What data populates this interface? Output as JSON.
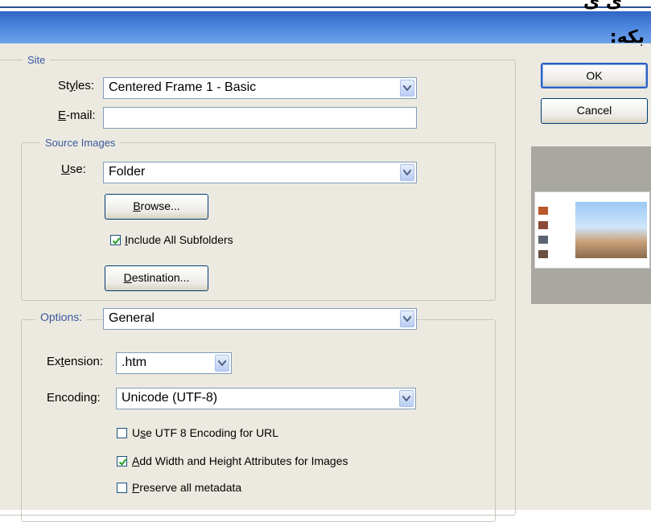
{
  "header": {
    "top_glyph": "ی ی",
    "rtl_text": "بکه:"
  },
  "site": {
    "legend": "Site",
    "styles_label_pre": "St",
    "styles_label_u": "y",
    "styles_label_post": "les:",
    "styles_value": "Centered Frame 1 - Basic",
    "email_label_u": "E",
    "email_label_post": "-mail:",
    "email_value": ""
  },
  "source_images": {
    "legend": "Source Images",
    "use_label_u": "U",
    "use_label_post": "se:",
    "use_value": "Folder",
    "browse_u": "B",
    "browse_post": "rowse...",
    "include_subfolders_u": "I",
    "include_subfolders_post": "nclude All Subfolders",
    "include_subfolders_checked": true,
    "destination_u": "D",
    "destination_post": "estination..."
  },
  "options": {
    "legend": "Options:",
    "value": "General",
    "extension_label_pre": "Ex",
    "extension_label_u": "t",
    "extension_label_post": "ension:",
    "extension_value": ".htm",
    "encoding_label": "Encoding:",
    "encoding_value": "Unicode (UTF-8)",
    "checkboxes": [
      {
        "pre": "U",
        "u": "s",
        "post": "e UTF 8 Encoding for URL",
        "checked": false
      },
      {
        "pre": "",
        "u": "A",
        "post": "dd Width and Height Attributes for Images",
        "checked": true
      },
      {
        "pre": "",
        "u": "P",
        "post": "reserve all metadata",
        "checked": false
      }
    ]
  },
  "buttons": {
    "ok": "OK",
    "cancel": "Cancel"
  },
  "colors": {
    "title_bar": "#4a84dd",
    "dialog_bg": "#eceae0",
    "legend_text": "#3a57a0"
  }
}
